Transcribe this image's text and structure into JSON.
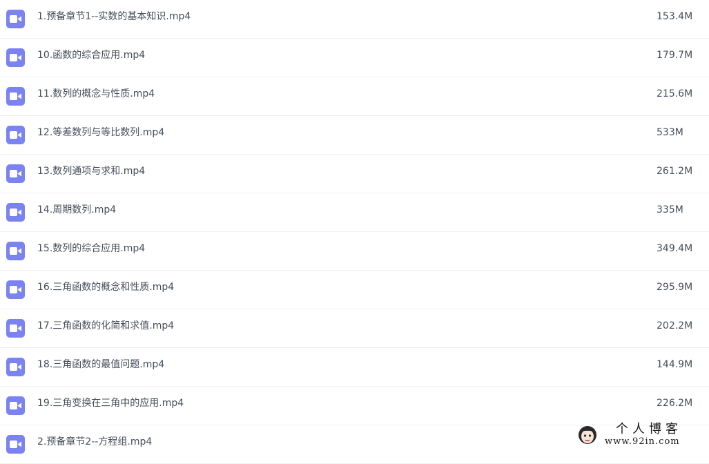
{
  "accent_color": "#7b83f2",
  "files": [
    {
      "name": "1.预备章节1--实数的基本知识.mp4",
      "size": "153.4M",
      "icon": "video-file-icon"
    },
    {
      "name": "10.函数的综合应用.mp4",
      "size": "179.7M",
      "icon": "video-file-icon"
    },
    {
      "name": "11.数列的概念与性质.mp4",
      "size": "215.6M",
      "icon": "video-file-icon"
    },
    {
      "name": "12.等差数列与等比数列.mp4",
      "size": "533M",
      "icon": "video-file-icon"
    },
    {
      "name": "13.数列通项与求和.mp4",
      "size": "261.2M",
      "icon": "video-file-icon"
    },
    {
      "name": "14.周期数列.mp4",
      "size": "335M",
      "icon": "video-file-icon"
    },
    {
      "name": "15.数列的综合应用.mp4",
      "size": "349.4M",
      "icon": "video-file-icon"
    },
    {
      "name": "16.三角函数的概念和性质.mp4",
      "size": "295.9M",
      "icon": "video-file-icon"
    },
    {
      "name": "17.三角函数的化简和求值.mp4",
      "size": "202.2M",
      "icon": "video-file-icon"
    },
    {
      "name": "18.三角函数的最值问题.mp4",
      "size": "144.9M",
      "icon": "video-file-icon"
    },
    {
      "name": "19.三角变换在三角中的应用.mp4",
      "size": "226.2M",
      "icon": "video-file-icon"
    },
    {
      "name": "2.预备章节2--方程组.mp4",
      "size": "",
      "icon": "video-file-icon"
    }
  ],
  "watermark": {
    "title": "个人博客",
    "url": "www.92in.com"
  }
}
